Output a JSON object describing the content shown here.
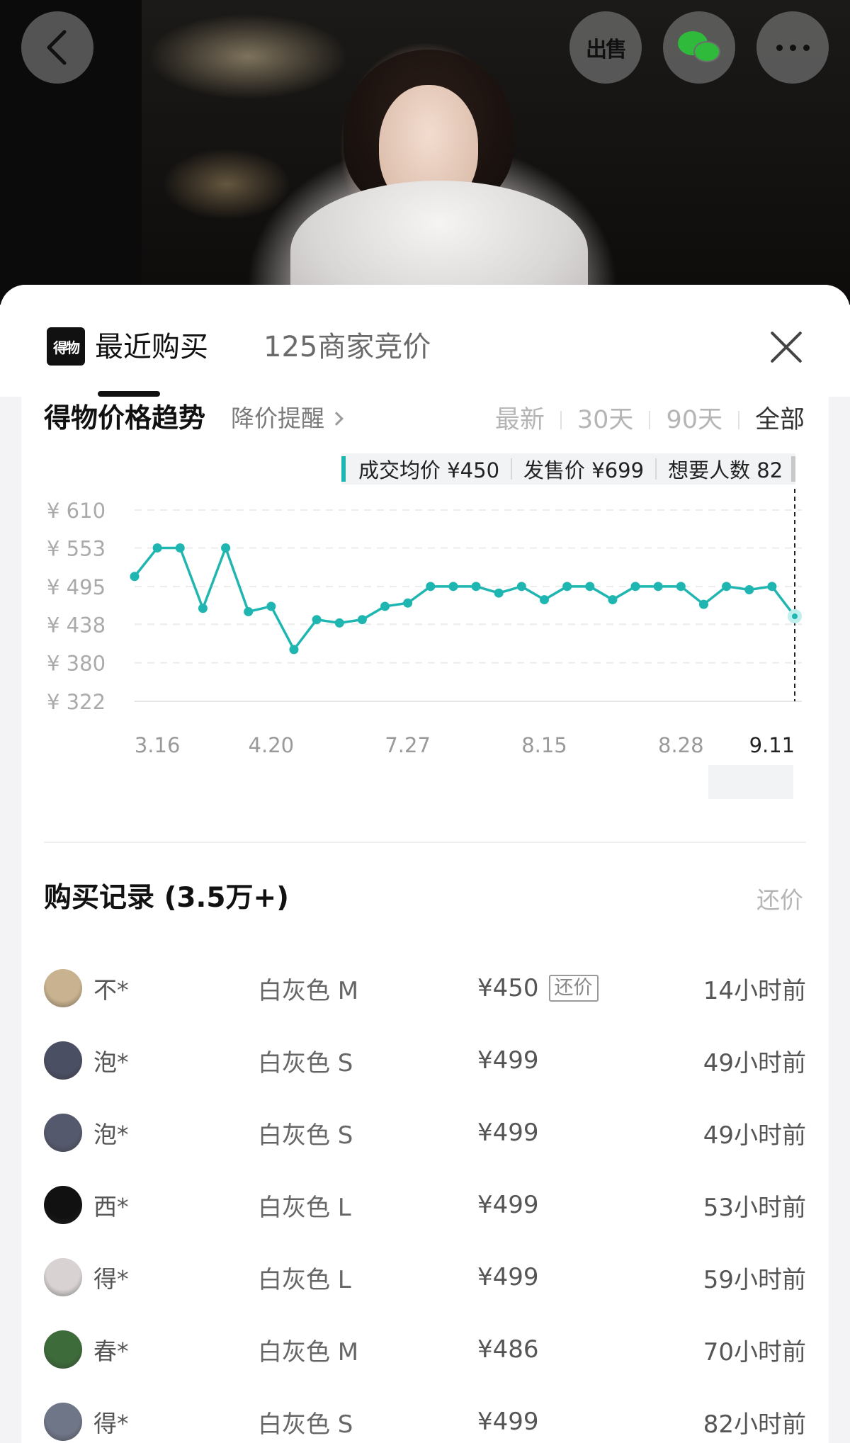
{
  "hero": {
    "back_icon": "chevron-left-icon",
    "sell_label": "出售",
    "wechat_icon": "wechat-icon",
    "more_icon": "more-dots-icon"
  },
  "sheet": {
    "logo_text": "得物",
    "tabs": [
      {
        "label": "最近购买",
        "active": true
      },
      {
        "label": "125商家竞价",
        "active": false
      }
    ],
    "close_icon": "close-icon"
  },
  "trend": {
    "title": "得物价格趋势",
    "reminder_label": "降价提醒",
    "ranges": [
      "最新",
      "30天",
      "90天",
      "全部"
    ],
    "active_range": "全部",
    "summary": {
      "avg_label": "成交均价 ¥450",
      "release_label": "发售价 ¥699",
      "want_label": "想要人数 82"
    },
    "accent_color": "#1fb6b1"
  },
  "chart_data": {
    "type": "line",
    "title": "",
    "xlabel": "",
    "ylabel": "",
    "y_ticks": [
      "¥ 610",
      "¥ 553",
      "¥ 495",
      "¥ 438",
      "¥ 380",
      "¥ 322"
    ],
    "y_tick_values": [
      610,
      553,
      495,
      438,
      380,
      322
    ],
    "ylim": [
      322,
      610
    ],
    "x_tick_labels": [
      "3.16",
      "4.20",
      "7.27",
      "8.15",
      "8.28",
      "9.11"
    ],
    "x_tick_positions": [
      1,
      6,
      12,
      18,
      24,
      28
    ],
    "selected_x": "9.11",
    "grid": true,
    "series": [
      {
        "color": "#1fb6b1",
        "values": [
          510,
          553,
          553,
          462,
          553,
          457,
          465,
          400,
          445,
          440,
          445,
          465,
          470,
          495,
          495,
          495,
          485,
          495,
          475,
          495,
          495,
          475,
          495,
          495,
          495,
          468,
          495,
          490,
          495,
          450
        ]
      }
    ]
  },
  "records": {
    "title": "购买记录 (3.5万+)",
    "counter_link": "还价",
    "rows": [
      {
        "user": "不*",
        "variant": "白灰色 M",
        "price": "¥450",
        "tag": "还价",
        "time": "14小时前",
        "avatar_color": "#c9b28f"
      },
      {
        "user": "泡*",
        "variant": "白灰色 S",
        "price": "¥499",
        "tag": "",
        "time": "49小时前",
        "avatar_color": "#4b4f63"
      },
      {
        "user": "泡*",
        "variant": "白灰色 S",
        "price": "¥499",
        "tag": "",
        "time": "49小时前",
        "avatar_color": "#55596d"
      },
      {
        "user": "西*",
        "variant": "白灰色 L",
        "price": "¥499",
        "tag": "",
        "time": "53小时前",
        "avatar_color": "#111111"
      },
      {
        "user": "得*",
        "variant": "白灰色 L",
        "price": "¥499",
        "tag": "",
        "time": "59小时前",
        "avatar_color": "#d8d2d2"
      },
      {
        "user": "春*",
        "variant": "白灰色 M",
        "price": "¥486",
        "tag": "",
        "time": "70小时前",
        "avatar_color": "#3e6b3a"
      },
      {
        "user": "得*",
        "variant": "白灰色 S",
        "price": "¥499",
        "tag": "",
        "time": "82小时前",
        "avatar_color": "#6f7688"
      }
    ]
  }
}
